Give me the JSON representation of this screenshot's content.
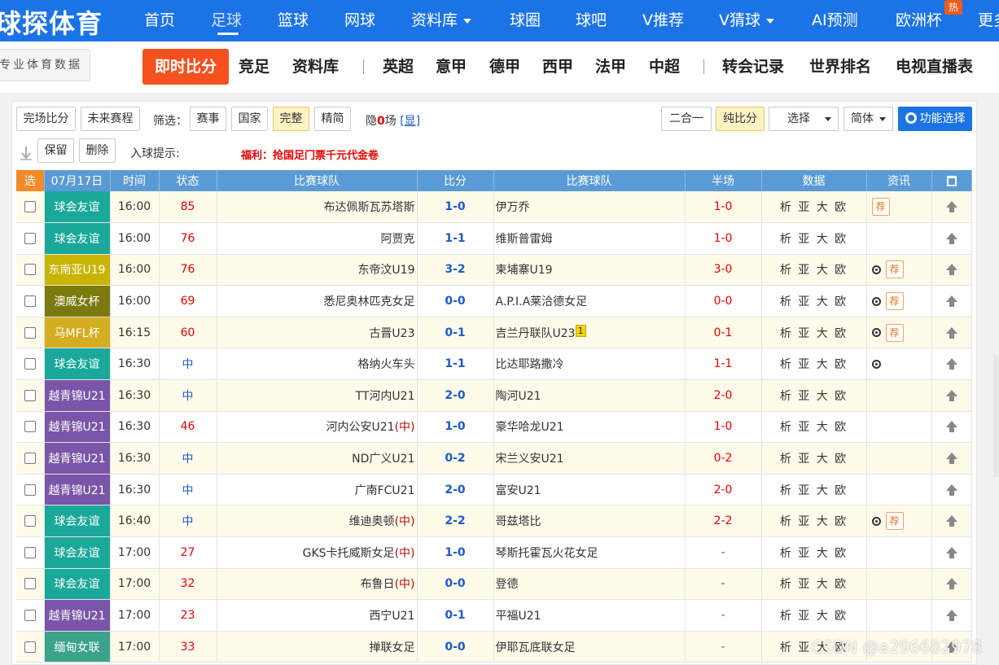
{
  "topnav": {
    "logo": "球探体育",
    "items": [
      "首页",
      "足球",
      "篮球",
      "网球",
      "资料库",
      "球圈",
      "球吧",
      "V推荐",
      "V猜球",
      "AI预测",
      "欧洲杯",
      "更多"
    ],
    "active_index": 1,
    "hot_badge": "热"
  },
  "subnav": {
    "logo_text": "专业体育数据",
    "live_label": "即时比分",
    "items": [
      "竞足",
      "资料库",
      "英超",
      "意甲",
      "德甲",
      "西甲",
      "法甲",
      "中超",
      "转会记录",
      "世界排名",
      "电视直播表"
    ]
  },
  "toolbar": {
    "finished": "完场比分",
    "upcoming": "未来赛程",
    "filter_label": "筛选：",
    "f_event": "赛事",
    "f_country": "国家",
    "f_full": "完整",
    "f_simple": "精简",
    "hidden_prefix": "隐",
    "hidden_count": "0",
    "hidden_suffix": "场",
    "show_link": "[显]",
    "two_in_one": "二合一",
    "pure_score": "纯比分",
    "select": "选择",
    "lang": "简体",
    "func_select": "功能选择",
    "keep": "保留",
    "delete": "删除",
    "goal_hint": "入球提示:",
    "promo": "福利：抢国足门票千元代金卷"
  },
  "table": {
    "headers": {
      "sel": "选",
      "date": "07月17日",
      "time": "时间",
      "status": "状态",
      "home": "比赛球队",
      "score": "比分",
      "away": "比赛球队",
      "half": "半场",
      "data": "数据",
      "info": "资讯"
    },
    "data_links": "析 亚 大 欧",
    "rec_label": "荐",
    "rows": [
      {
        "league": "球会友谊",
        "league_color": "#1aa89a",
        "time": "16:00",
        "status": "85",
        "status_type": "red",
        "home": "布达佩斯瓦苏塔斯",
        "home_neutral": "",
        "score": "1-0",
        "away": "伊万乔",
        "away_card": "",
        "half": "1-0",
        "ball": false,
        "rec": true
      },
      {
        "league": "球会友谊",
        "league_color": "#1aa89a",
        "time": "16:00",
        "status": "76",
        "status_type": "red",
        "home": "阿贾克",
        "home_neutral": "",
        "score": "1-1",
        "away": "维斯普雷姆",
        "away_card": "",
        "half": "1-0",
        "ball": false,
        "rec": false
      },
      {
        "league": "东南亚U19",
        "league_color": "#c9b400",
        "time": "16:00",
        "status": "76",
        "status_type": "red",
        "home": "东帝汶U19",
        "home_neutral": "",
        "score": "3-2",
        "away": "柬埔寨U19",
        "away_card": "",
        "half": "3-0",
        "ball": true,
        "rec": true
      },
      {
        "league": "澳威女杯",
        "league_color": "#7a7a0f",
        "time": "16:00",
        "status": "69",
        "status_type": "red",
        "home": "悉尼奥林匹克女足",
        "home_neutral": "",
        "score": "0-0",
        "away": "A.P.I.A莱洽德女足",
        "away_card": "",
        "half": "0-0",
        "ball": true,
        "rec": true
      },
      {
        "league": "马MFL杯",
        "league_color": "#d4ad21",
        "time": "16:15",
        "status": "60",
        "status_type": "red",
        "home": "古晋U23",
        "home_neutral": "",
        "score": "0-1",
        "away": "吉兰丹联队U23",
        "away_card": "1",
        "half": "0-1",
        "ball": true,
        "rec": true
      },
      {
        "league": "球会友谊",
        "league_color": "#1aa89a",
        "time": "16:30",
        "status": "中",
        "status_type": "blue",
        "home": "格纳火车头",
        "home_neutral": "",
        "score": "1-1",
        "away": "比达耶路撒冷",
        "away_card": "",
        "half": "1-1",
        "ball": true,
        "rec": false
      },
      {
        "league": "越青锦U21",
        "league_color": "#7a55a8",
        "time": "16:30",
        "status": "中",
        "status_type": "blue",
        "home": "TT河内U21",
        "home_neutral": "",
        "score": "2-0",
        "away": "陶河U21",
        "away_card": "",
        "half": "2-0",
        "ball": false,
        "rec": false
      },
      {
        "league": "越青锦U21",
        "league_color": "#7a55a8",
        "time": "16:30",
        "status": "46",
        "status_type": "red",
        "home": "河内公安U21",
        "home_neutral": "(中)",
        "score": "1-0",
        "away": "豪华哈龙U21",
        "away_card": "",
        "half": "1-0",
        "ball": false,
        "rec": false
      },
      {
        "league": "越青锦U21",
        "league_color": "#7a55a8",
        "time": "16:30",
        "status": "中",
        "status_type": "blue",
        "home": "ND广义U21",
        "home_neutral": "",
        "score": "0-2",
        "away": "宋兰义安U21",
        "away_card": "",
        "half": "0-2",
        "ball": false,
        "rec": false
      },
      {
        "league": "越青锦U21",
        "league_color": "#7a55a8",
        "time": "16:30",
        "status": "中",
        "status_type": "blue",
        "home": "广南FCU21",
        "home_neutral": "",
        "score": "2-0",
        "away": "富安U21",
        "away_card": "",
        "half": "2-0",
        "ball": false,
        "rec": false
      },
      {
        "league": "球会友谊",
        "league_color": "#1aa89a",
        "time": "16:40",
        "status": "中",
        "status_type": "blue",
        "home": "维迪奥顿",
        "home_neutral": "(中)",
        "score": "2-2",
        "away": "哥兹塔比",
        "away_card": "",
        "half": "2-2",
        "ball": true,
        "rec": true
      },
      {
        "league": "球会友谊",
        "league_color": "#1aa89a",
        "time": "17:00",
        "status": "27",
        "status_type": "red",
        "home": "GKS卡托威斯女足",
        "home_neutral": "(中)",
        "score": "1-0",
        "away": "琴斯托霍瓦火花女足",
        "away_card": "",
        "half": "-",
        "ball": false,
        "rec": false
      },
      {
        "league": "球会友谊",
        "league_color": "#1aa89a",
        "time": "17:00",
        "status": "32",
        "status_type": "red",
        "home": "布鲁日",
        "home_neutral": "(中)",
        "score": "0-0",
        "away": "登德",
        "away_card": "",
        "half": "-",
        "ball": false,
        "rec": false
      },
      {
        "league": "越青锦U21",
        "league_color": "#7a55a8",
        "time": "17:00",
        "status": "23",
        "status_type": "red",
        "home": "西宁U21",
        "home_neutral": "",
        "score": "0-1",
        "away": "平福U21",
        "away_card": "",
        "half": "-",
        "ball": false,
        "rec": false
      },
      {
        "league": "缅甸女联",
        "league_color": "#3aa38a",
        "time": "17:00",
        "status": "33",
        "status_type": "red",
        "home": "掸联女足",
        "home_neutral": "",
        "score": "0-0",
        "away": "伊耶瓦底联女足",
        "away_card": "",
        "half": "-",
        "ball": false,
        "rec": false
      }
    ]
  },
  "watermark": "CSDN @a296682978"
}
